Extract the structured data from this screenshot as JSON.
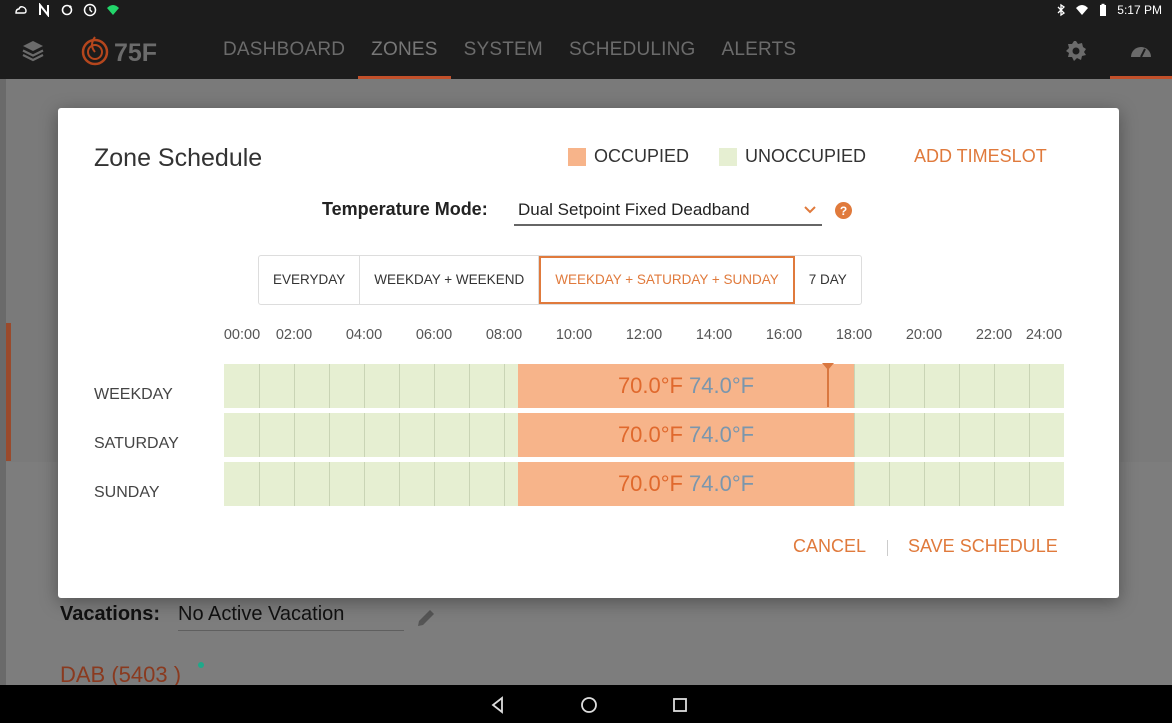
{
  "status_bar": {
    "time": "5:17 PM"
  },
  "app_bar": {
    "logo_text": "75F",
    "nav": [
      {
        "label": "DASHBOARD",
        "active": false
      },
      {
        "label": "ZONES",
        "active": true
      },
      {
        "label": "SYSTEM",
        "active": false
      },
      {
        "label": "SCHEDULING",
        "active": false
      },
      {
        "label": "ALERTS",
        "active": false
      }
    ],
    "icons": [
      "layers-icon",
      "gear-icon",
      "gauge-icon"
    ]
  },
  "background_page": {
    "vacations_label": "Vacations:",
    "vacations_value": "No Active Vacation",
    "equipment_label": "DAB (5403 )"
  },
  "dialog": {
    "title": "Zone Schedule",
    "legend": [
      {
        "label": "OCCUPIED",
        "color": "#f7b48a"
      },
      {
        "label": "UNOCCUPIED",
        "color": "#e6efd2"
      }
    ],
    "add_timeslot_label": "ADD TIMESLOT",
    "temperature_mode": {
      "label": "Temperature Mode:",
      "selected": "Dual Setpoint Fixed Deadband"
    },
    "schedule_types": [
      {
        "label": "EVERYDAY",
        "active": false
      },
      {
        "label": "WEEKDAY + WEEKEND",
        "active": false
      },
      {
        "label": "WEEKDAY + SATURDAY + SUNDAY",
        "active": true
      },
      {
        "label": "7 DAY",
        "active": false
      }
    ],
    "hour_labels": [
      "00:00",
      "02:00",
      "04:00",
      "06:00",
      "08:00",
      "10:00",
      "12:00",
      "14:00",
      "16:00",
      "18:00",
      "20:00",
      "22:00",
      "24:00"
    ],
    "rows": [
      {
        "day": "WEEKDAY",
        "start_hour": 8.4,
        "end_hour": 18.0,
        "heat": "70.0°F",
        "cool": "74.0°F"
      },
      {
        "day": "SATURDAY",
        "start_hour": 8.4,
        "end_hour": 18.0,
        "heat": "70.0°F",
        "cool": "74.0°F"
      },
      {
        "day": "SUNDAY",
        "start_hour": 8.4,
        "end_hour": 18.0,
        "heat": "70.0°F",
        "cool": "74.0°F"
      }
    ],
    "cancel_label": "CANCEL",
    "save_label": "SAVE SCHEDULE",
    "accent_color": "#e07a3c"
  }
}
